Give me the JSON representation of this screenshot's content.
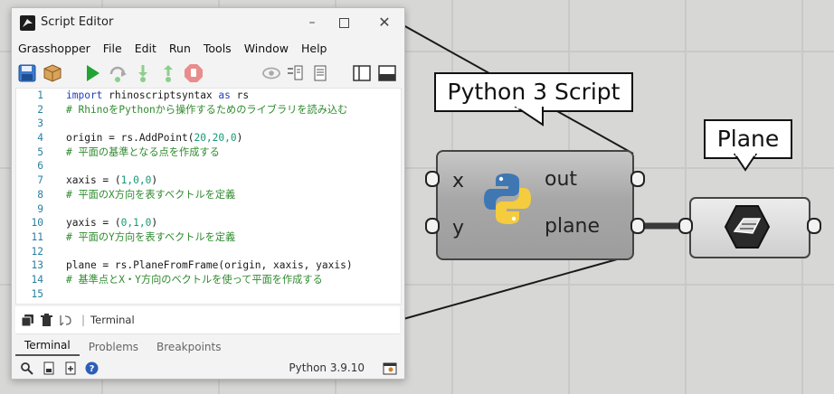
{
  "window": {
    "title": "Script Editor",
    "minimize": "–",
    "close": "✕"
  },
  "menu": [
    "Grasshopper",
    "File",
    "Edit",
    "Run",
    "Tools",
    "Window",
    "Help"
  ],
  "code": {
    "lines": [
      {
        "n": "1",
        "kw": "import",
        "rest": " rhinoscriptsyntax ",
        "kw2": "as",
        "rest2": " rs"
      },
      {
        "n": "2",
        "comment": "# RhinoをPythonから操作するためのライブラリを読み込む"
      },
      {
        "n": "3"
      },
      {
        "n": "4",
        "pre": "origin = rs.AddPoint(",
        "num": "20,20,0",
        "post": ")"
      },
      {
        "n": "5",
        "comment": "# 平面の基準となる点を作成する"
      },
      {
        "n": "6"
      },
      {
        "n": "7",
        "pre": "xaxis = (",
        "num": "1,0,0",
        "post": ")"
      },
      {
        "n": "8",
        "comment": "# 平面のX方向を表すベクトルを定義"
      },
      {
        "n": "9"
      },
      {
        "n": "10",
        "pre": "yaxis = (",
        "num": "0,1,0",
        "post": ")"
      },
      {
        "n": "11",
        "comment": "# 平面のY方向を表すベクトルを定義"
      },
      {
        "n": "12"
      },
      {
        "n": "13",
        "pre": "plane = rs.PlaneFromFrame(origin, xaxis, yaxis)"
      },
      {
        "n": "14",
        "comment": "# 基準点とX・Y方向のベクトルを使って平面を作成する"
      },
      {
        "n": "15"
      }
    ]
  },
  "terminal": {
    "label": "Terminal",
    "separator": "|"
  },
  "tabs": [
    "Terminal",
    "Problems",
    "Breakpoints"
  ],
  "status": {
    "python_version": "Python 3.9.10"
  },
  "gh": {
    "script_bubble": "Python 3 Script",
    "plane_bubble": "Plane",
    "inputs": [
      "x",
      "y"
    ],
    "outputs": [
      "out",
      "plane"
    ]
  },
  "colors": {
    "comment": "#2f8a2f",
    "keyword": "#1f3fbf",
    "number": "#159a73",
    "line_number": "#2a7fa0"
  }
}
